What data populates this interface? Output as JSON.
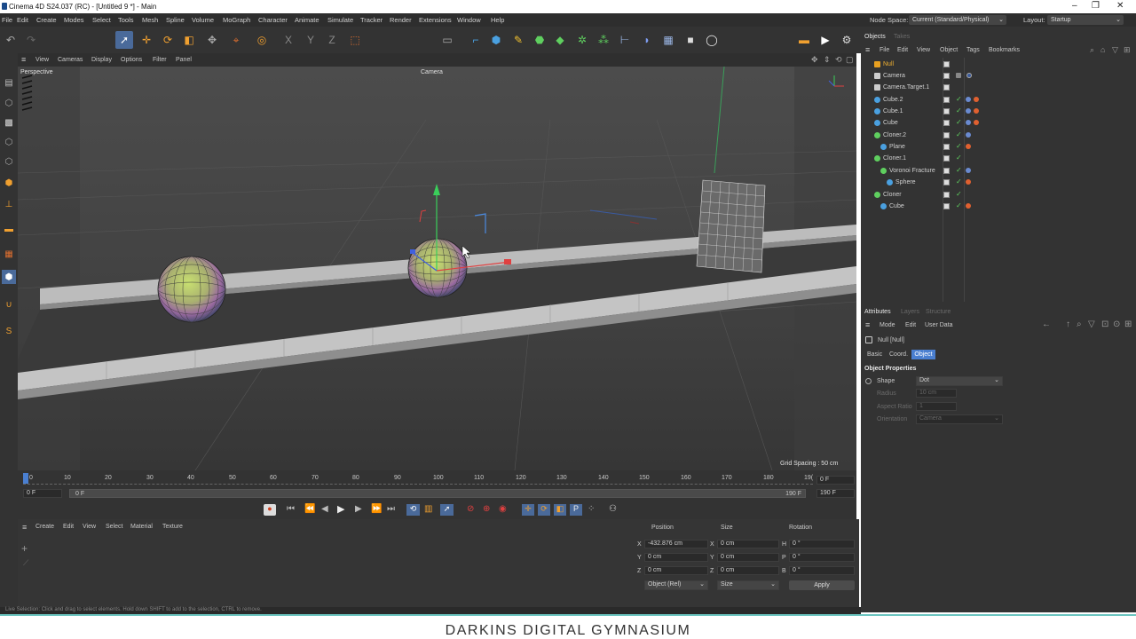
{
  "window": {
    "title": "Cinema 4D S24.037 (RC) - [Untitled 9 *] - Main",
    "controls": [
      "–",
      "❐",
      "✕"
    ]
  },
  "menu": [
    "File",
    "Edit",
    "Create",
    "Modes",
    "Select",
    "Tools",
    "Mesh",
    "Spline",
    "Volume",
    "MoGraph",
    "Character",
    "Animate",
    "Simulate",
    "Tracker",
    "Render",
    "Extensions",
    "Window",
    "Help"
  ],
  "nodespace": {
    "label": "Node Space:",
    "value": "Current (Standard/Physical)"
  },
  "layout": {
    "label": "Layout:",
    "value": "Startup"
  },
  "viewport": {
    "menu": [
      "View",
      "Cameras",
      "Display",
      "Options",
      "Filter",
      "Panel"
    ],
    "name": "Perspective",
    "camera": "Camera",
    "grid_spacing": "Grid Spacing : 50 cm"
  },
  "timeline": {
    "ticks": [
      "0",
      "10",
      "20",
      "30",
      "40",
      "50",
      "60",
      "70",
      "80",
      "90",
      "100",
      "110",
      "120",
      "130",
      "140",
      "150",
      "160",
      "170",
      "180",
      "19("
    ],
    "current_frame": "0 F",
    "start": "0 F",
    "range_start": "0 F",
    "range_end": "190 F",
    "end": "190 F"
  },
  "material_menu": [
    "Create",
    "Edit",
    "View",
    "Select",
    "Material",
    "Texture"
  ],
  "coords": {
    "headers": [
      "Position",
      "Size",
      "Rotation"
    ],
    "position": [
      {
        "axis": "X",
        "value": "-432.876 cm"
      },
      {
        "axis": "Y",
        "value": "0 cm"
      },
      {
        "axis": "Z",
        "value": "0 cm"
      }
    ],
    "size": [
      {
        "axis": "X",
        "value": "0 cm"
      },
      {
        "axis": "Y",
        "value": "0 cm"
      },
      {
        "axis": "Z",
        "value": "0 cm"
      }
    ],
    "rotation": [
      {
        "axis": "H",
        "value": "0 °"
      },
      {
        "axis": "P",
        "value": "0 °"
      },
      {
        "axis": "B",
        "value": "0 °"
      }
    ],
    "mode": "Object (Rel)",
    "size_mode": "Size",
    "apply": "Apply"
  },
  "objects": {
    "tabs": [
      "Objects",
      "Takes"
    ],
    "menu": [
      "File",
      "Edit",
      "View",
      "Object",
      "Tags",
      "Bookmarks"
    ],
    "items": [
      {
        "name": "Null",
        "color": "#e8a020",
        "depth": 0
      },
      {
        "name": "Camera",
        "color": "#cccccc",
        "depth": 0
      },
      {
        "name": "Camera.Target.1",
        "color": "#cccccc",
        "depth": 0
      },
      {
        "name": "Cube.2",
        "color": "#4aa0e0",
        "depth": 0
      },
      {
        "name": "Cube.1",
        "color": "#4aa0e0",
        "depth": 0
      },
      {
        "name": "Cube",
        "color": "#4aa0e0",
        "depth": 0
      },
      {
        "name": "Cloner.2",
        "color": "#5fcf5f",
        "depth": 0
      },
      {
        "name": "Plane",
        "color": "#4aa0e0",
        "depth": 1
      },
      {
        "name": "Cloner.1",
        "color": "#5fcf5f",
        "depth": 0
      },
      {
        "name": "Voronoi Fracture",
        "color": "#5fcf5f",
        "depth": 1
      },
      {
        "name": "Sphere",
        "color": "#4aa0e0",
        "depth": 2
      },
      {
        "name": "Cloner",
        "color": "#5fcf5f",
        "depth": 0
      },
      {
        "name": "Cube",
        "color": "#4aa0e0",
        "depth": 1
      }
    ]
  },
  "attributes": {
    "tabs": [
      "Attributes",
      "Layers",
      "Structure"
    ],
    "menu": [
      "Mode",
      "Edit",
      "User Data"
    ],
    "object_label": "Null [Null]",
    "subtabs": [
      "Basic",
      "Coord.",
      "Object"
    ],
    "section": "Object Properties",
    "props": [
      {
        "label": "Shape",
        "value": "Dot",
        "enabled": true
      },
      {
        "label": "Radius",
        "value": "10 cm",
        "enabled": false
      },
      {
        "label": "Aspect Ratio",
        "value": "1",
        "enabled": false
      },
      {
        "label": "Orientation",
        "value": "Camera",
        "enabled": false
      }
    ]
  },
  "status": "Live Selection: Click and drag to select elements. Hold down SHIFT to add to the selection, CTRL to remove.",
  "caption": "DARKINS DIGITAL GYMNASIUM",
  "colors": {
    "accent": "#4a6a9a",
    "caption_line": "#6bc5c0",
    "selection": "#4a7fd0"
  }
}
